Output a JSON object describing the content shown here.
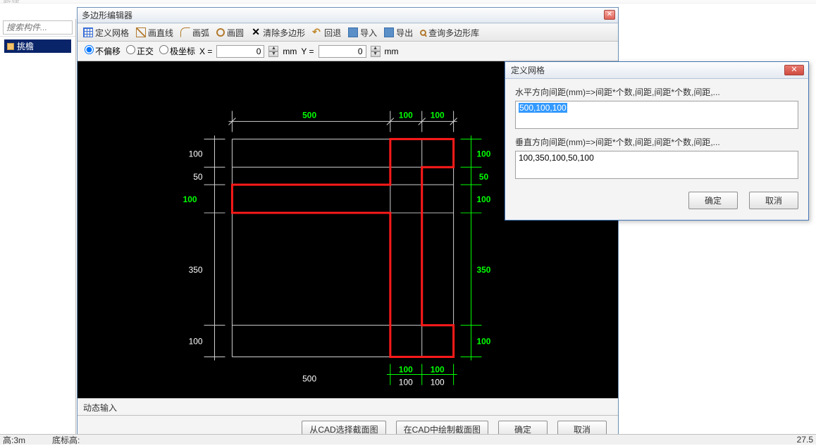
{
  "app": {
    "topbar_new": "新建",
    "editor_title": "多边形编辑器",
    "dyn_input": "动态输入"
  },
  "sidebar": {
    "search_placeholder": "搜索构件...",
    "item": "挑檐"
  },
  "toolbar": {
    "grid": "定义网格",
    "line": "画直线",
    "arc": "画弧",
    "circle": "画圆",
    "clear": "清除多边形",
    "undo": "回退",
    "import": "导入",
    "export": "导出",
    "query": "查询多边形库"
  },
  "coord": {
    "opt1": "不偏移",
    "opt2": "正交",
    "opt3": "极坐标",
    "xlabel": "X =",
    "xval": "0",
    "ylabel": "Y =",
    "yval": "0",
    "unit": "mm"
  },
  "buttons": {
    "select_from_cad": "从CAD选择截面图",
    "draw_in_cad": "在CAD中绘制截面图",
    "ok": "确定",
    "cancel": "取消"
  },
  "dialog": {
    "title": "定义网格",
    "h_label": "水平方向间距(mm)=>间距*个数,间距,间距*个数,间距,...",
    "h_value": "500,100,100",
    "v_label": "垂直方向间距(mm)=>间距*个数,间距,间距*个数,间距,...",
    "v_value": "100,350,100,50,100",
    "ok": "确定",
    "cancel": "取消"
  },
  "status": {
    "height": "高:3m",
    "base": "底标高:",
    "right": "27.5"
  },
  "chart_data": {
    "type": "diagram",
    "grid_x_mm": [
      500,
      100,
      100
    ],
    "grid_y_mm": [
      100,
      350,
      100,
      50,
      100
    ],
    "top_dims": [
      "500",
      "100",
      "100"
    ],
    "left_dims": [
      "100",
      "50",
      "100",
      "350",
      "100"
    ],
    "right_dims_green": [
      "100",
      "50",
      "100",
      "350",
      "100"
    ],
    "bottom_upper": [
      "100",
      "100"
    ],
    "bottom_lower": [
      "500",
      "100",
      "100"
    ],
    "red_polygon_note": "L-shaped section outline",
    "colors": {
      "grid": "#ffffff",
      "dims_white": "#ffffff",
      "dims_green": "#00ff00",
      "shape": "#ff0000"
    }
  }
}
